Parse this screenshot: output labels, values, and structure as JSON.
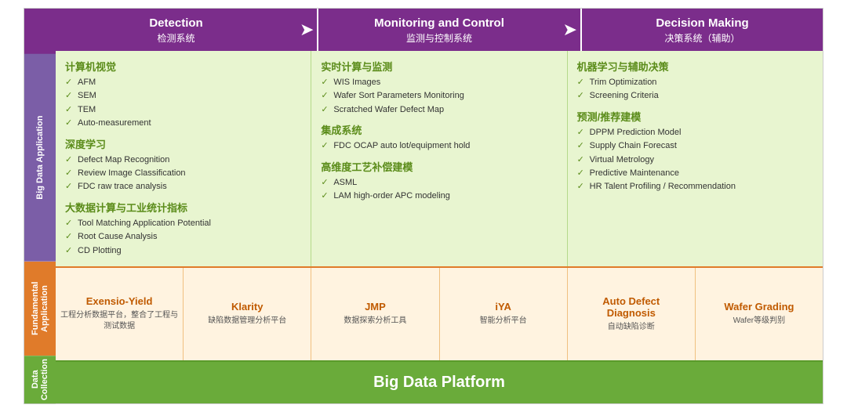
{
  "header": {
    "col1": {
      "title": "Detection",
      "subtitle": "检测系统"
    },
    "col2": {
      "title": "Monitoring and Control",
      "subtitle": "监测与控制系统"
    },
    "col3": {
      "title": "Decision Making",
      "subtitle": "决策系统（辅助）"
    }
  },
  "row_labels": {
    "big_data": "Big Data Application",
    "fundamental": "Fundamental Application",
    "data_collection": "Data Collection"
  },
  "big_data": {
    "col1": {
      "sections": [
        {
          "title": "计算机视觉",
          "items": [
            "AFM",
            "SEM",
            "TEM",
            "Auto-measurement"
          ]
        },
        {
          "title": "深度学习",
          "items": [
            "Defect Map Recognition",
            "Review Image Classification",
            "FDC raw trace analysis"
          ]
        },
        {
          "title": "大数据计算与工业统计指标",
          "items": [
            "Tool Matching Application Potential",
            "Root Cause Analysis",
            "CD Plotting"
          ]
        }
      ]
    },
    "col2": {
      "sections": [
        {
          "title": "实时计算与监测",
          "items": [
            "WIS Images",
            "Wafer Sort Parameters Monitoring",
            "Scratched Wafer Defect Map"
          ]
        },
        {
          "title": "集成系统",
          "items": [
            "FDC OCAP auto lot/equipment hold"
          ]
        },
        {
          "title": "高维度工艺补偿建模",
          "items": [
            "ASML",
            "LAM high-order APC modeling"
          ]
        }
      ]
    },
    "col3": {
      "sections": [
        {
          "title": "机器学习与辅助决策",
          "items": [
            "Trim Optimization",
            "Screening Criteria"
          ]
        },
        {
          "title": "预测/推荐建模",
          "items": [
            "DPPM Prediction Model",
            "Supply Chain Forecast",
            "Virtual Metrology",
            "Predictive Maintenance",
            "HR Talent Profiling / Recommendation"
          ]
        }
      ]
    }
  },
  "fundamental": {
    "cells": [
      {
        "title": "Exensio-Yield",
        "subtitle": "工程分析数据平台，整合了工程与测试数据"
      },
      {
        "title": "Klarity",
        "subtitle": "缺陷数据管理分析平台"
      },
      {
        "title": "JMP",
        "subtitle": "数据探索分析工具"
      },
      {
        "title": "iYA",
        "subtitle": "智能分析平台"
      },
      {
        "title": "Auto Defect\nDiagnosis",
        "subtitle": "自动缺陷诊断"
      },
      {
        "title": "Wafer  Grading",
        "subtitle": "Wafer等级判别"
      }
    ]
  },
  "data_collection": {
    "text": "Big Data Platform"
  }
}
